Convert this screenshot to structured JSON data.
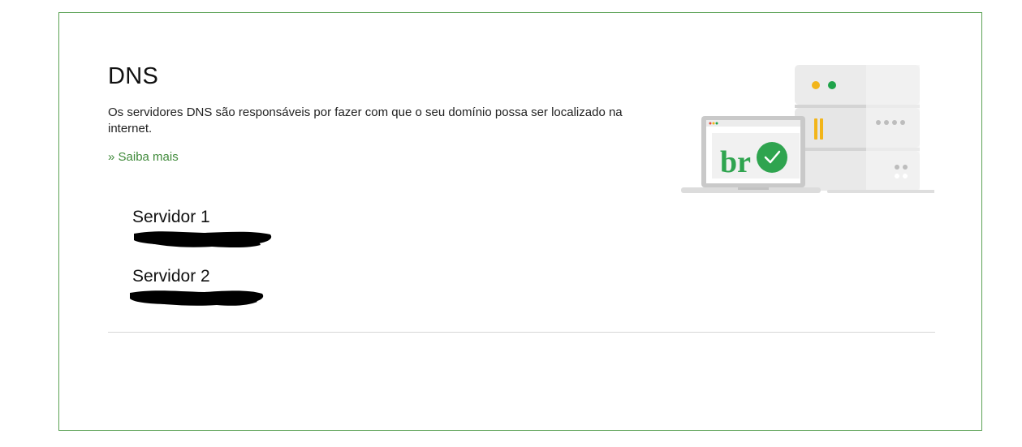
{
  "section": {
    "title": "DNS",
    "description": "Os servidores DNS são responsáveis por fazer com que o seu domínio possa ser localizado na internet.",
    "learn_more": "» Saiba mais"
  },
  "servers": [
    {
      "label": "Servidor 1",
      "value": ""
    },
    {
      "label": "Servidor 2",
      "value": ""
    }
  ],
  "illustration": {
    "laptop_text": "br",
    "icons": [
      "server-rack-icon",
      "laptop-icon",
      "check-circle-icon"
    ]
  },
  "colors": {
    "accent": "#3f8a3a",
    "border": "#5aa154",
    "check": "#2fa44f",
    "yellow": "#f2b51a",
    "green_dot": "#1fa34a"
  }
}
